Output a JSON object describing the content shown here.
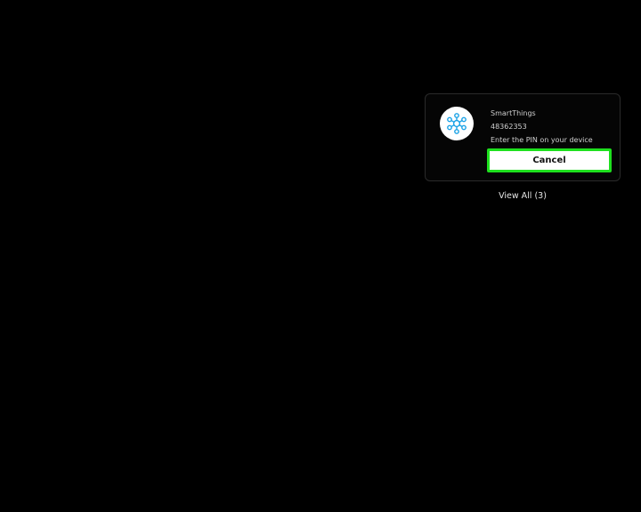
{
  "notification": {
    "app_name": "SmartThings",
    "code": "48362353",
    "message": "Enter the PIN on your device",
    "icon": "smartthings-icon",
    "icon_color": "#1aa2e6",
    "cancel_label": "Cancel",
    "focus_color": "#1ee01e"
  },
  "view_all": {
    "label": "View All (3)"
  }
}
